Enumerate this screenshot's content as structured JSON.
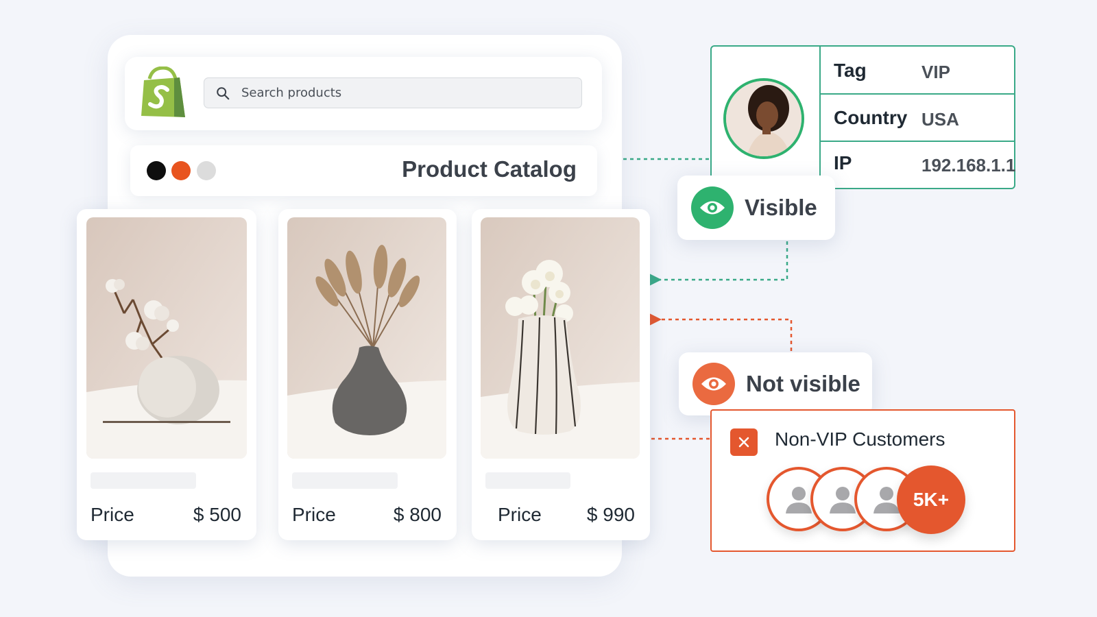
{
  "search": {
    "placeholder": "Search products"
  },
  "catalog": {
    "title": "Product Catalog",
    "dots": [
      "#0e0e0e",
      "#e8541f",
      "#dcdcdc"
    ]
  },
  "products": [
    {
      "price_label": "Price",
      "price": "$ 500"
    },
    {
      "price_label": "Price",
      "price": "$ 800"
    },
    {
      "price_label": "Price",
      "price": "$ 990"
    }
  ],
  "customer": {
    "rows": [
      {
        "key": "Tag",
        "value": "VIP"
      },
      {
        "key": "Country",
        "value": "USA"
      },
      {
        "key": "IP",
        "value": "192.168.1.1"
      }
    ]
  },
  "visibility": {
    "visible_label": "Visible",
    "not_visible_label": "Not visible"
  },
  "audience": {
    "title": "Non-VIP Customers",
    "count": "5K+"
  },
  "colors": {
    "green": "#2eb26f",
    "teal_border": "#39a987",
    "orange": "#e4572e"
  }
}
